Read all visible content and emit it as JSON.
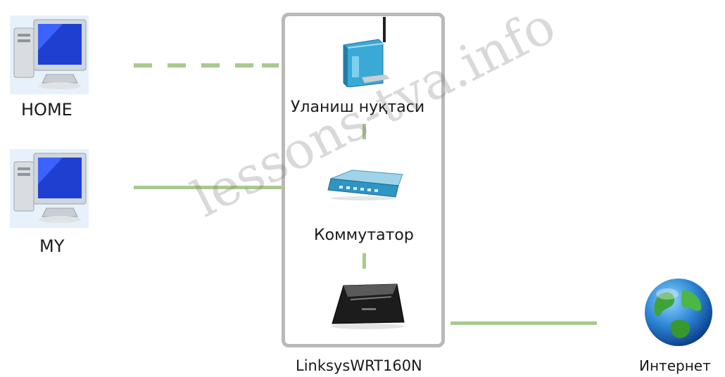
{
  "nodes": {
    "home": {
      "label": "HOME"
    },
    "my": {
      "label": "MY"
    },
    "access_point": {
      "label": "Уланиш нуқтаси"
    },
    "switch": {
      "label": "Коммутатор"
    },
    "router": {
      "label": "LinksysWRT160N"
    },
    "internet": {
      "label": "Интернет"
    }
  },
  "watermark": "lessons-tva.info",
  "colors": {
    "connector": "#a9c98f",
    "device_box_border": "#b9b9b9"
  }
}
